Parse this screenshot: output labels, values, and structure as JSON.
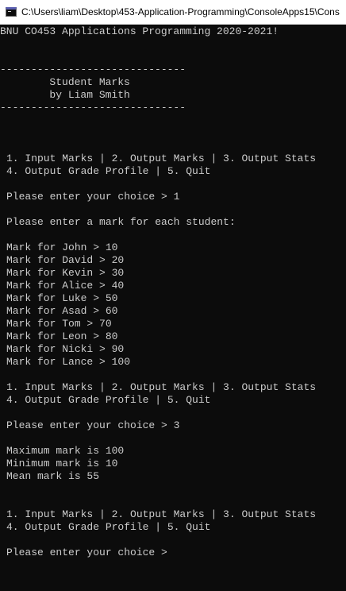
{
  "window": {
    "title": "C:\\Users\\liam\\Desktop\\453-Application-Programming\\ConsoleApps15\\Cons",
    "icon": "console-app-icon"
  },
  "console": {
    "text_color": "#cccccc",
    "background": "#0c0c0c",
    "lines": [
      "BNU CO453 Applications Programming 2020-2021!",
      "------------------------------",
      "        Student Marks",
      "        by Liam Smith",
      "------------------------------",
      "1. Input Marks | 2. Output Marks | 3. Output Stats",
      "4. Output Grade Profile | 5. Quit",
      "Please enter your choice > 1",
      "Please enter a mark for each student:",
      "Mark for John > 10",
      "Mark for David > 20",
      "Mark for Kevin > 30",
      "Mark for Alice > 40",
      "Mark for Luke > 50",
      "Mark for Asad > 60",
      "Mark for Tom > 70",
      "Mark for Leon > 80",
      "Mark for Nicki > 90",
      "Mark for Lance > 100",
      "1. Input Marks | 2. Output Marks | 3. Output Stats",
      "4. Output Grade Profile | 5. Quit",
      "Please enter your choice > 3",
      "Maximum mark is 100",
      "Minimum mark is 10",
      "Mean mark is 55",
      "1. Input Marks | 2. Output Marks | 3. Output Stats",
      "4. Output Grade Profile | 5. Quit",
      "Please enter your choice > "
    ]
  }
}
